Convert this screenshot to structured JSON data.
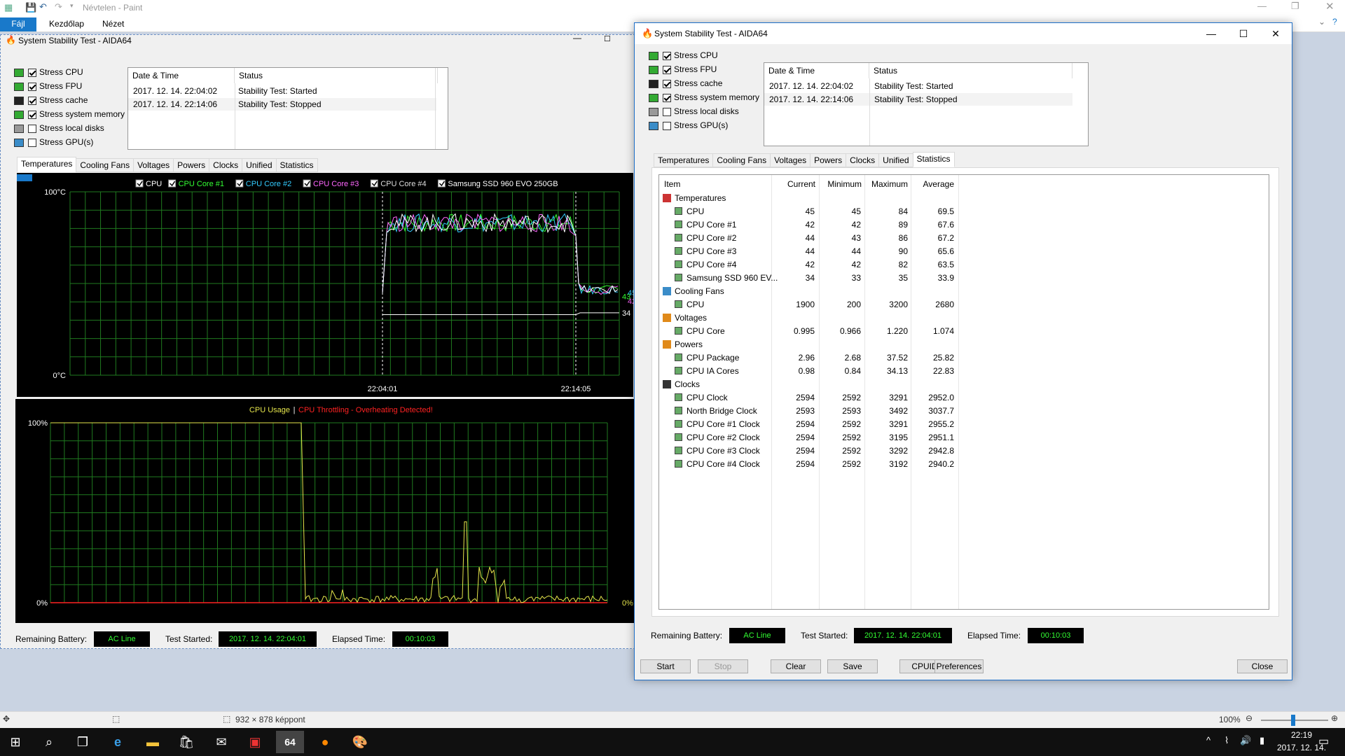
{
  "paint": {
    "title": "Névtelen - Paint",
    "ribbon_tabs": [
      "Fájl",
      "Kezdőlap",
      "Nézet"
    ],
    "status_size": "932 × 878 képpont",
    "zoom": "100%"
  },
  "taskbar": {
    "time": "22:19",
    "date": "2017. 12. 14."
  },
  "left": {
    "title": "System Stability Test - AIDA64",
    "stress": [
      {
        "label": "Stress CPU",
        "checked": true
      },
      {
        "label": "Stress FPU",
        "checked": true
      },
      {
        "label": "Stress cache",
        "checked": true
      },
      {
        "label": "Stress system memory",
        "checked": true
      },
      {
        "label": "Stress local disks",
        "checked": false
      },
      {
        "label": "Stress GPU(s)",
        "checked": false
      }
    ],
    "log_headers": [
      "Date & Time",
      "Status"
    ],
    "log": [
      {
        "date": "2017. 12. 14. 22:04:02",
        "status": "Stability Test: Started"
      },
      {
        "date": "2017. 12. 14. 22:14:06",
        "status": "Stability Test: Stopped"
      }
    ],
    "tabs": [
      "Temperatures",
      "Cooling Fans",
      "Voltages",
      "Powers",
      "Clocks",
      "Unified",
      "Statistics"
    ],
    "temp_legend": [
      {
        "label": "CPU",
        "color": "#ffffff"
      },
      {
        "label": "CPU Core #1",
        "color": "#33ff33"
      },
      {
        "label": "CPU Core #2",
        "color": "#33ccff"
      },
      {
        "label": "CPU Core #3",
        "color": "#ff66ff"
      },
      {
        "label": "CPU Core #4",
        "color": "#dddddd"
      },
      {
        "label": "Samsung SSD 960 EVO 250GB",
        "color": "#ffffff"
      }
    ],
    "temp_ymax": "100°C",
    "temp_ymin": "0°C",
    "temp_xlabels": [
      "22:04:01",
      "22:14:05"
    ],
    "temp_end_labels": [
      "43",
      "45",
      "42",
      "34"
    ],
    "usage_title": "CPU Usage",
    "usage_sep": "|",
    "usage_warning": "CPU Throttling - Overheating Detected!",
    "usage_ymax": "100%",
    "usage_ymin": "0%",
    "usage_end": "0%",
    "usage_end2": "0%",
    "battery_label": "Remaining Battery:",
    "battery_value": "AC Line",
    "started_label": "Test Started:",
    "started_value": "2017. 12. 14. 22:04:01",
    "elapsed_label": "Elapsed Time:",
    "elapsed_value": "00:10:03"
  },
  "right": {
    "title": "System Stability Test - AIDA64",
    "active_tab": "Statistics",
    "grid_headers": [
      "Item",
      "Current",
      "Minimum",
      "Maximum",
      "Average"
    ],
    "rows": [
      {
        "type": "cat",
        "item": "Temperatures"
      },
      {
        "type": "item",
        "item": "CPU",
        "cur": "45",
        "min": "45",
        "max": "84",
        "avg": "69.5"
      },
      {
        "type": "item",
        "item": "CPU Core #1",
        "cur": "42",
        "min": "42",
        "max": "89",
        "avg": "67.6"
      },
      {
        "type": "item",
        "item": "CPU Core #2",
        "cur": "44",
        "min": "43",
        "max": "86",
        "avg": "67.2"
      },
      {
        "type": "item",
        "item": "CPU Core #3",
        "cur": "44",
        "min": "44",
        "max": "90",
        "avg": "65.6"
      },
      {
        "type": "item",
        "item": "CPU Core #4",
        "cur": "42",
        "min": "42",
        "max": "82",
        "avg": "63.5"
      },
      {
        "type": "item",
        "item": "Samsung SSD 960 EV...",
        "cur": "34",
        "min": "33",
        "max": "35",
        "avg": "33.9"
      },
      {
        "type": "cat",
        "item": "Cooling Fans"
      },
      {
        "type": "item",
        "item": "CPU",
        "cur": "1900",
        "min": "200",
        "max": "3200",
        "avg": "2680"
      },
      {
        "type": "cat",
        "item": "Voltages"
      },
      {
        "type": "item",
        "item": "CPU Core",
        "cur": "0.995",
        "min": "0.966",
        "max": "1.220",
        "avg": "1.074"
      },
      {
        "type": "cat",
        "item": "Powers"
      },
      {
        "type": "item",
        "item": "CPU Package",
        "cur": "2.96",
        "min": "2.68",
        "max": "37.52",
        "avg": "25.82"
      },
      {
        "type": "item",
        "item": "CPU IA Cores",
        "cur": "0.98",
        "min": "0.84",
        "max": "34.13",
        "avg": "22.83"
      },
      {
        "type": "cat",
        "item": "Clocks"
      },
      {
        "type": "item",
        "item": "CPU Clock",
        "cur": "2594",
        "min": "2592",
        "max": "3291",
        "avg": "2952.0"
      },
      {
        "type": "item",
        "item": "North Bridge Clock",
        "cur": "2593",
        "min": "2593",
        "max": "3492",
        "avg": "3037.7"
      },
      {
        "type": "item",
        "item": "CPU Core #1 Clock",
        "cur": "2594",
        "min": "2592",
        "max": "3291",
        "avg": "2955.2"
      },
      {
        "type": "item",
        "item": "CPU Core #2 Clock",
        "cur": "2594",
        "min": "2592",
        "max": "3195",
        "avg": "2951.1"
      },
      {
        "type": "item",
        "item": "CPU Core #3 Clock",
        "cur": "2594",
        "min": "2592",
        "max": "3292",
        "avg": "2942.8"
      },
      {
        "type": "item",
        "item": "CPU Core #4 Clock",
        "cur": "2594",
        "min": "2592",
        "max": "3192",
        "avg": "2940.2"
      }
    ],
    "buttons": {
      "start": "Start",
      "stop": "Stop",
      "clear": "Clear",
      "save": "Save",
      "cpuid": "CPUID",
      "preferences": "Preferences",
      "close": "Close"
    }
  },
  "colors": {
    "accent": "#1e6fc8",
    "graph_grid": "#1f7a1f",
    "status_green": "#33ff33",
    "warning_red": "#ff2222",
    "usage_yellow": "#e6e64c"
  }
}
